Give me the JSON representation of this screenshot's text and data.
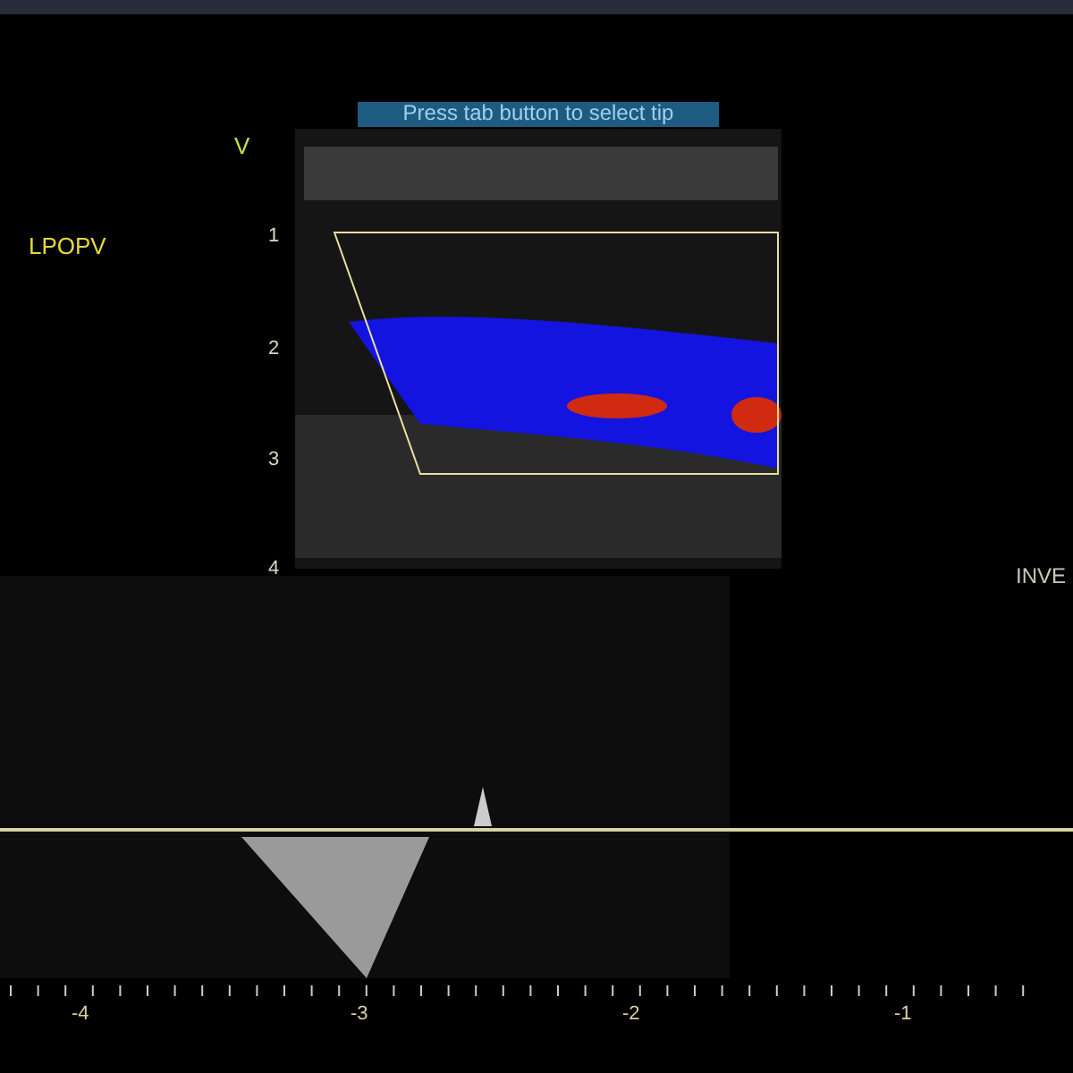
{
  "banner": "Press tab button to select tip",
  "orientation_mark": "V",
  "annotation": "LPOPV",
  "depth_scale": [
    "1",
    "2",
    "3",
    "4"
  ],
  "side_label": "INVE",
  "velocity_axis": [
    "-4",
    "-3",
    "-2",
    "-1"
  ]
}
